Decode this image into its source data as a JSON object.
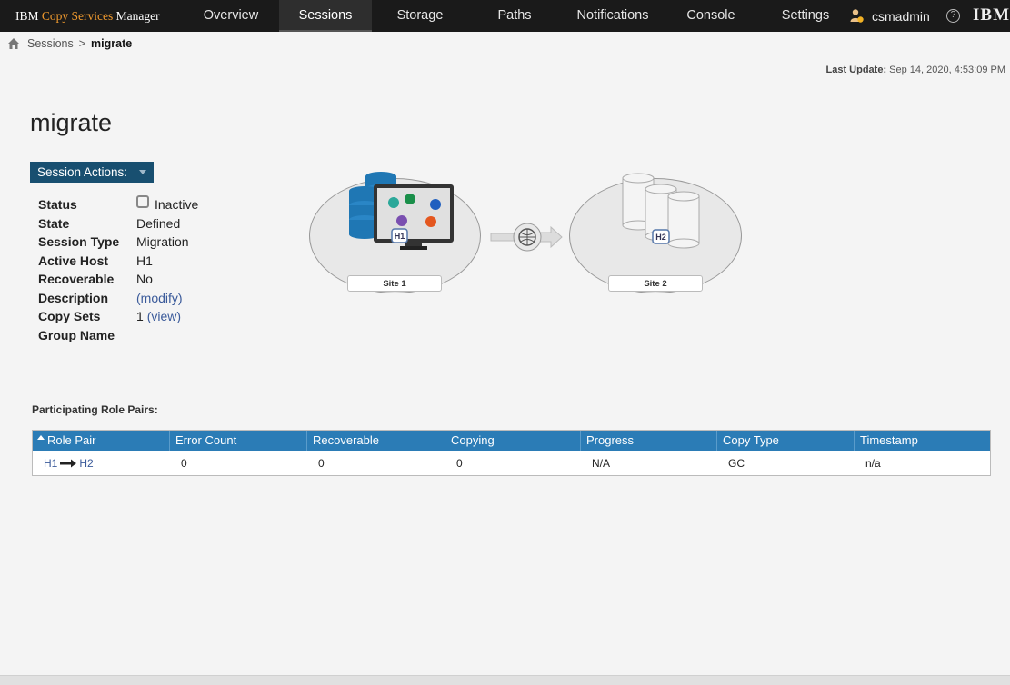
{
  "brand": {
    "prefix": "IBM ",
    "accent": "Copy Services",
    "suffix": " Manager"
  },
  "nav": {
    "items": [
      "Overview",
      "Sessions",
      "Storage",
      "Paths",
      "Notifications",
      "Console",
      "Settings"
    ],
    "active": "Sessions"
  },
  "user": {
    "name": "csmadmin",
    "help": "?",
    "logo": "IBM"
  },
  "breadcrumb": {
    "parent": "Sessions",
    "separator": ">",
    "current": "migrate"
  },
  "last_update": {
    "label": "Last Update:",
    "value": "Sep 14, 2020, 4:53:09 PM"
  },
  "page": {
    "title": "migrate",
    "actions_label": "Session Actions:"
  },
  "properties": {
    "status_label": "Status",
    "status_value": "Inactive",
    "state_label": "State",
    "state_value": "Defined",
    "type_label": "Session Type",
    "type_value": "Migration",
    "host_label": "Active Host",
    "host_value": "H1",
    "recoverable_label": "Recoverable",
    "recoverable_value": "No",
    "description_label": "Description",
    "description_link": "(modify)",
    "copysets_label": "Copy Sets",
    "copysets_count": "1",
    "copysets_link": "(view)",
    "group_label": "Group Name"
  },
  "diagram": {
    "site1": "Site 1",
    "site2": "Site 2",
    "h1": "H1",
    "h2": "H2"
  },
  "role_pairs": {
    "section_label": "Participating Role Pairs:",
    "columns": [
      "Role Pair",
      "Error Count",
      "Recoverable",
      "Copying",
      "Progress",
      "Copy Type",
      "Timestamp"
    ],
    "rows": [
      {
        "from": "H1",
        "to": "H2",
        "error_count": "0",
        "recoverable": "0",
        "copying": "0",
        "progress": "N/A",
        "copy_type": "GC",
        "timestamp": "n/a"
      }
    ]
  },
  "colors": {
    "topbar": "#1a1a1a",
    "accent": "#f29b2e",
    "header_blue": "#2b7cb6",
    "actions_blue": "#184f70",
    "link": "#3a5a9a"
  }
}
